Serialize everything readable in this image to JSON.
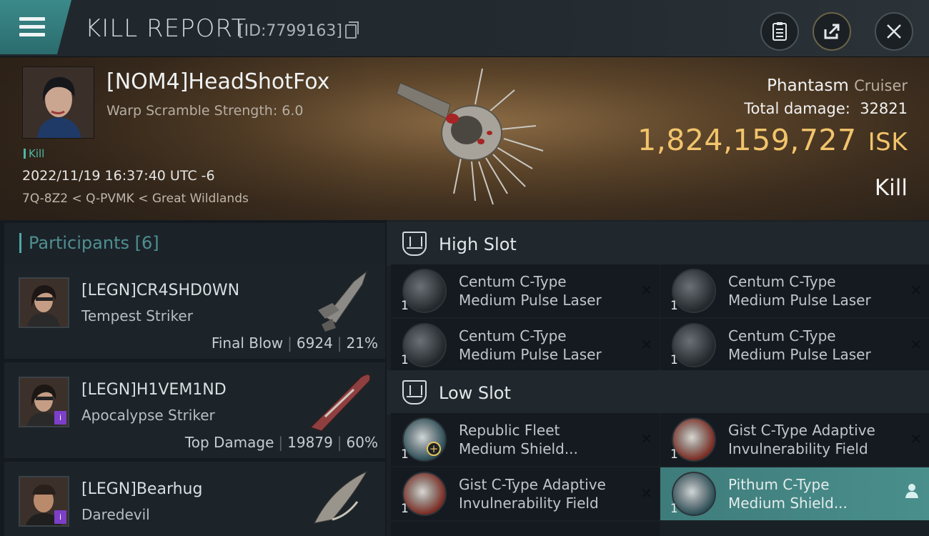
{
  "header": {
    "title": "KILL REPORT",
    "report_id": "[ID:7799163]"
  },
  "victim": {
    "name": "[NOM4]HeadShotFox",
    "warp_scramble": "Warp Scramble Strength: 6.0",
    "tag": "Kill",
    "timestamp": "2022/11/19 16:37:40 UTC -6",
    "location": "7Q-8Z2 < Q-PVMK < Great Wildlands",
    "ship": "Phantasm",
    "ship_class": "Cruiser",
    "total_damage_label": "Total damage:",
    "total_damage": "32821",
    "isk_value": "1,824,159,727",
    "isk_unit": "ISK",
    "result": "Kill"
  },
  "participants": {
    "label": "Participants",
    "count": "[6]",
    "items": [
      {
        "name": "[LEGN]CR4SHD0WN",
        "ship": "Tempest Striker",
        "role": "Final Blow",
        "damage": "6924",
        "percent": "21%",
        "badge": ""
      },
      {
        "name": "[LEGN]H1VEM1ND",
        "ship": "Apocalypse Striker",
        "role": "Top Damage",
        "damage": "19879",
        "percent": "60%",
        "badge": "i"
      },
      {
        "name": "[LEGN]Bearhug",
        "ship": "Daredevil",
        "role": "",
        "damage": "",
        "percent": "",
        "badge": "i"
      }
    ]
  },
  "slots": {
    "high": {
      "label": "High Slot",
      "items": [
        {
          "qty": "1",
          "line1": "Centum C-Type",
          "line2": "Medium Pulse Laser"
        },
        {
          "qty": "1",
          "line1": "Centum C-Type",
          "line2": "Medium Pulse Laser"
        },
        {
          "qty": "1",
          "line1": "Centum C-Type",
          "line2": "Medium Pulse Laser"
        },
        {
          "qty": "1",
          "line1": "Centum C-Type",
          "line2": "Medium Pulse Laser"
        }
      ]
    },
    "low": {
      "label": "Low Slot",
      "items": [
        {
          "qty": "1",
          "line1": "Republic Fleet",
          "line2": "Medium Shield..."
        },
        {
          "qty": "1",
          "line1": "Gist C-Type Adaptive",
          "line2": "Invulnerability Field"
        },
        {
          "qty": "1",
          "line1": "Gist C-Type Adaptive",
          "line2": "Invulnerability Field"
        },
        {
          "qty": "1",
          "line1": "Pithum C-Type",
          "line2": "Medium Shield..."
        }
      ]
    }
  },
  "icons": {
    "menu": "hamburger-icon",
    "copy": "copy-icon",
    "clipboard": "clipboard-icon",
    "share": "share-icon",
    "close": "close-icon",
    "dropped": "close-x-icon",
    "fitted": "user-icon"
  },
  "colors": {
    "accent": "#4fa6a9",
    "isk": "#f2c46b",
    "badge": "#7b3fc8"
  }
}
